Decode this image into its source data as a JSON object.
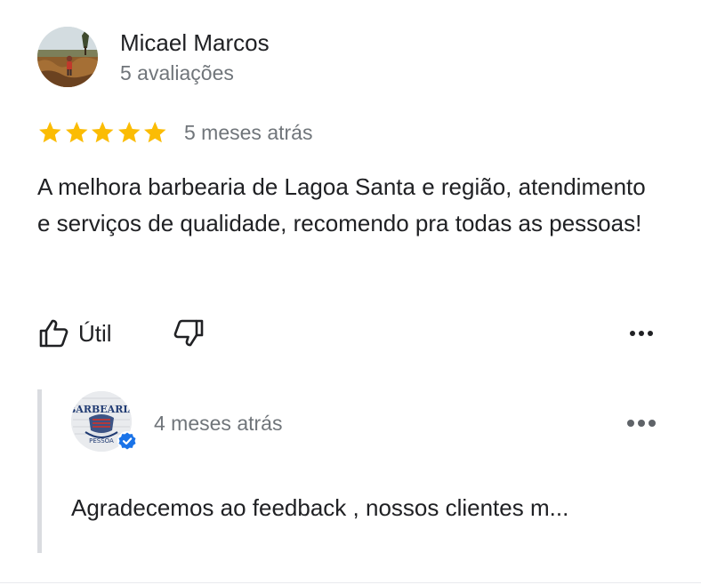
{
  "review": {
    "reviewer_name": "Micael Marcos",
    "reviewer_reviews": "5 avaliações",
    "rating": 5,
    "rating_max": 5,
    "time": "5 meses atrás",
    "text": "A melhora barbearia de Lagoa Santa e região, atendimento e serviços de qualidade, recomendo pra todas as pessoas!",
    "helpful_label": "Útil",
    "icons": {
      "avatar": "reviewer-avatar-photo",
      "star": "star-icon",
      "helpful": "thumbs-up-icon",
      "unhelpful": "thumbs-down-icon",
      "more": "more-options-icon"
    }
  },
  "owner_reply": {
    "time": "4 meses atrás",
    "text": "Agradecemos ao feedback , nossos clientes m...",
    "logo_text": "BARBEARIA",
    "logo_subtext": "PESSOA",
    "icons": {
      "avatar": "business-logo",
      "verified": "verified-badge-icon",
      "more": "more-options-icon"
    }
  },
  "colors": {
    "star": "#fbbc04",
    "primary_text": "#202124",
    "secondary_text": "#70757a",
    "verified": "#1a73e8",
    "reply_bar": "#dadce0"
  }
}
